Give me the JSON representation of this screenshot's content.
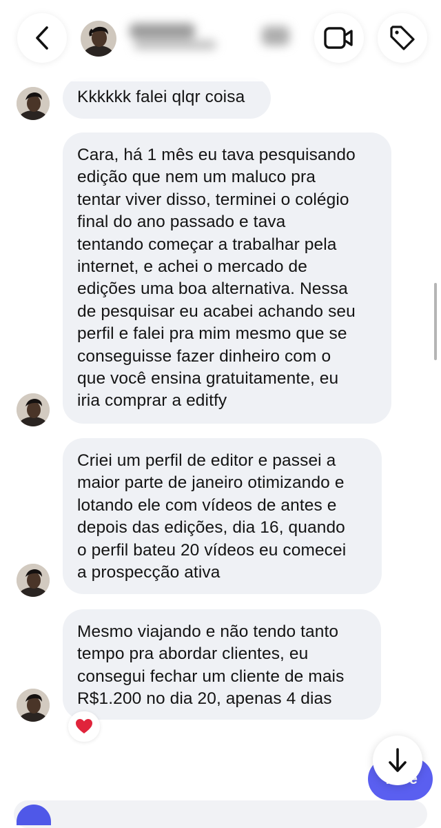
{
  "header": {
    "back_icon": "chevron-left-icon",
    "video_icon": "video-camera-icon",
    "tag_icon": "tag-icon",
    "contact_name_blurred": true
  },
  "messages": [
    {
      "lines": [
        "Kkkkkk falei qlqr coisa"
      ]
    },
    {
      "lines": [
        "Cara, há 1 mês eu tava pesquisando",
        "edição que nem um maluco pra",
        "tentar viver disso, terminei o colégio",
        "final do ano passado e tava",
        "tentando começar a trabalhar pela",
        "internet, e achei o mercado de",
        "edições uma boa alternativa. Nessa",
        "de pesquisar eu acabei achando seu",
        "perfil e falei pra mim mesmo que se",
        "conseguisse fazer dinheiro com o",
        "que você ensina gratuitamente, eu",
        "iria comprar a editfy"
      ]
    },
    {
      "lines": [
        "Criei um perfil de editor e passei a",
        "maior parte de janeiro otimizando e",
        "lotando ele com vídeos de antes e",
        "depois das edições, dia 16, quando",
        "o perfil bateu 20 vídeos eu comecei",
        "a prospecção ativa"
      ]
    },
    {
      "lines": [
        "Mesmo viajando e não tendo tanto",
        "tempo pra abordar clientes, eu",
        "consegui fechar um cliente de mais",
        "R$1.200 no dia 20, apenas 4 dias"
      ],
      "reaction": "❤️"
    }
  ],
  "bottom": {
    "pill_label": "Nice",
    "scroll_icon": "arrow-down-icon"
  },
  "colors": {
    "bubble": "#eff1f5",
    "accent": "#5a5ff0",
    "heart": "#e0243b"
  }
}
